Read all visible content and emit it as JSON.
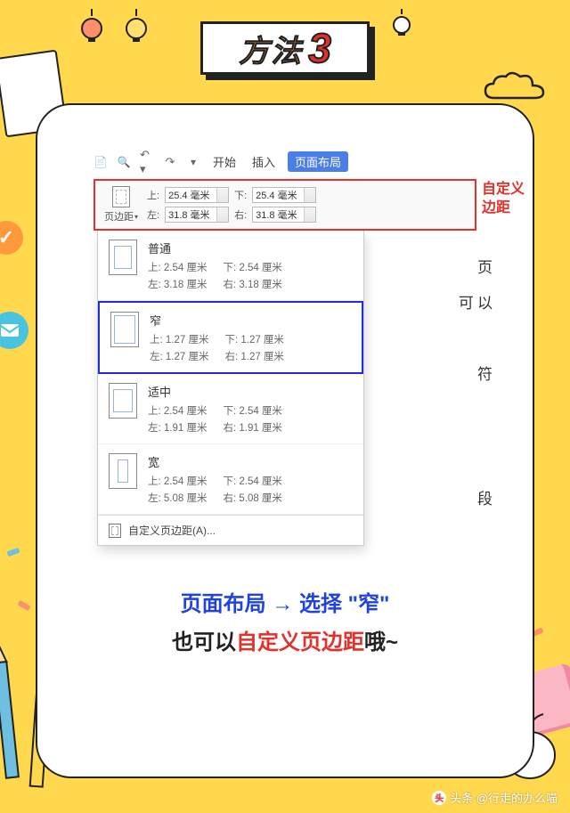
{
  "title": {
    "text": "方法",
    "number": "3"
  },
  "ribbon": {
    "tabs": {
      "start": "开始",
      "insert": "插入",
      "layout": "页面布局"
    }
  },
  "margin_button_label": "页边距",
  "custom_margins": {
    "top_label": "上:",
    "top_value": "25.4 毫米",
    "bottom_label": "下:",
    "bottom_value": "25.4 毫米",
    "left_label": "左:",
    "left_value": "31.8 毫米",
    "right_label": "右:",
    "right_value": "31.8 毫米"
  },
  "red_annotation": {
    "line1": "自定义",
    "line2": "边距"
  },
  "presets": [
    {
      "name": "普通",
      "top": "上: 2.54 厘米",
      "bottom": "下: 2.54 厘米",
      "left": "左: 3.18 厘米",
      "right": "右: 3.18 厘米"
    },
    {
      "name": "窄",
      "top": "上: 1.27 厘米",
      "bottom": "下: 1.27 厘米",
      "left": "左: 1.27 厘米",
      "right": "右: 1.27 厘米"
    },
    {
      "name": "适中",
      "top": "上: 2.54 厘米",
      "bottom": "下: 2.54 厘米",
      "left": "左: 1.91 厘米",
      "right": "右: 1.91 厘米"
    },
    {
      "name": "宽",
      "top": "上: 2.54 厘米",
      "bottom": "下: 2.54 厘米",
      "left": "左: 5.08 厘米",
      "right": "右: 5.08 厘米"
    }
  ],
  "custom_menu_item": "自定义页边距(A)...",
  "peek": {
    "a": "页",
    "b": "可 以",
    "c": "符",
    "d": "段"
  },
  "caption": {
    "line1_a": "页面布局 → 选择",
    "line1_b": "\"窄\"",
    "line2_a": "也可以",
    "line2_b": "自定义页边距",
    "line2_c": "哦~"
  },
  "watermark": "头条 @行走的办么喵"
}
